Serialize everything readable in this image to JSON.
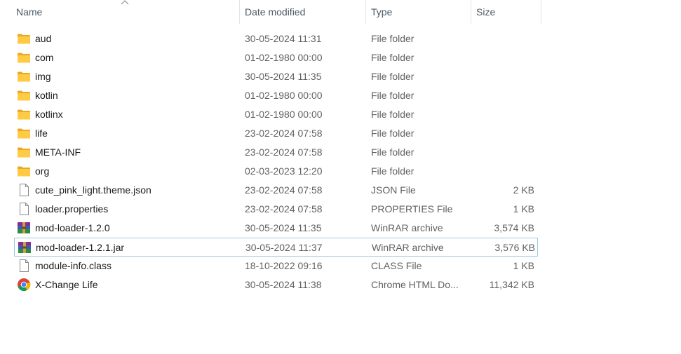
{
  "columns": {
    "name": "Name",
    "date": "Date modified",
    "type": "Type",
    "size": "Size"
  },
  "sort": {
    "column": "name",
    "direction": "ascending"
  },
  "files": [
    {
      "name": "aud",
      "date": "30-05-2024 11:31",
      "type": "File folder",
      "size": "",
      "icon": "folder-icon"
    },
    {
      "name": "com",
      "date": "01-02-1980 00:00",
      "type": "File folder",
      "size": "",
      "icon": "folder-icon"
    },
    {
      "name": "img",
      "date": "30-05-2024 11:35",
      "type": "File folder",
      "size": "",
      "icon": "folder-icon"
    },
    {
      "name": "kotlin",
      "date": "01-02-1980 00:00",
      "type": "File folder",
      "size": "",
      "icon": "folder-icon"
    },
    {
      "name": "kotlinx",
      "date": "01-02-1980 00:00",
      "type": "File folder",
      "size": "",
      "icon": "folder-icon"
    },
    {
      "name": "life",
      "date": "23-02-2024 07:58",
      "type": "File folder",
      "size": "",
      "icon": "folder-icon"
    },
    {
      "name": "META-INF",
      "date": "23-02-2024 07:58",
      "type": "File folder",
      "size": "",
      "icon": "folder-icon"
    },
    {
      "name": "org",
      "date": "02-03-2023 12:20",
      "type": "File folder",
      "size": "",
      "icon": "folder-icon"
    },
    {
      "name": "cute_pink_light.theme.json",
      "date": "23-02-2024 07:58",
      "type": "JSON File",
      "size": "2 KB",
      "icon": "file-icon"
    },
    {
      "name": "loader.properties",
      "date": "23-02-2024 07:58",
      "type": "PROPERTIES File",
      "size": "1 KB",
      "icon": "file-icon"
    },
    {
      "name": "mod-loader-1.2.0",
      "date": "30-05-2024 11:35",
      "type": "WinRAR archive",
      "size": "3,574 KB",
      "icon": "winrar-icon"
    },
    {
      "name": "mod-loader-1.2.1.jar",
      "date": "30-05-2024 11:37",
      "type": "WinRAR archive",
      "size": "3,576 KB",
      "icon": "winrar-icon",
      "selected": true
    },
    {
      "name": "module-info.class",
      "date": "18-10-2022 09:16",
      "type": "CLASS File",
      "size": "1 KB",
      "icon": "file-icon"
    },
    {
      "name": "X-Change Life",
      "date": "30-05-2024 11:38",
      "type": "Chrome HTML Do...",
      "size": "11,342 KB",
      "icon": "chrome-icon"
    }
  ]
}
